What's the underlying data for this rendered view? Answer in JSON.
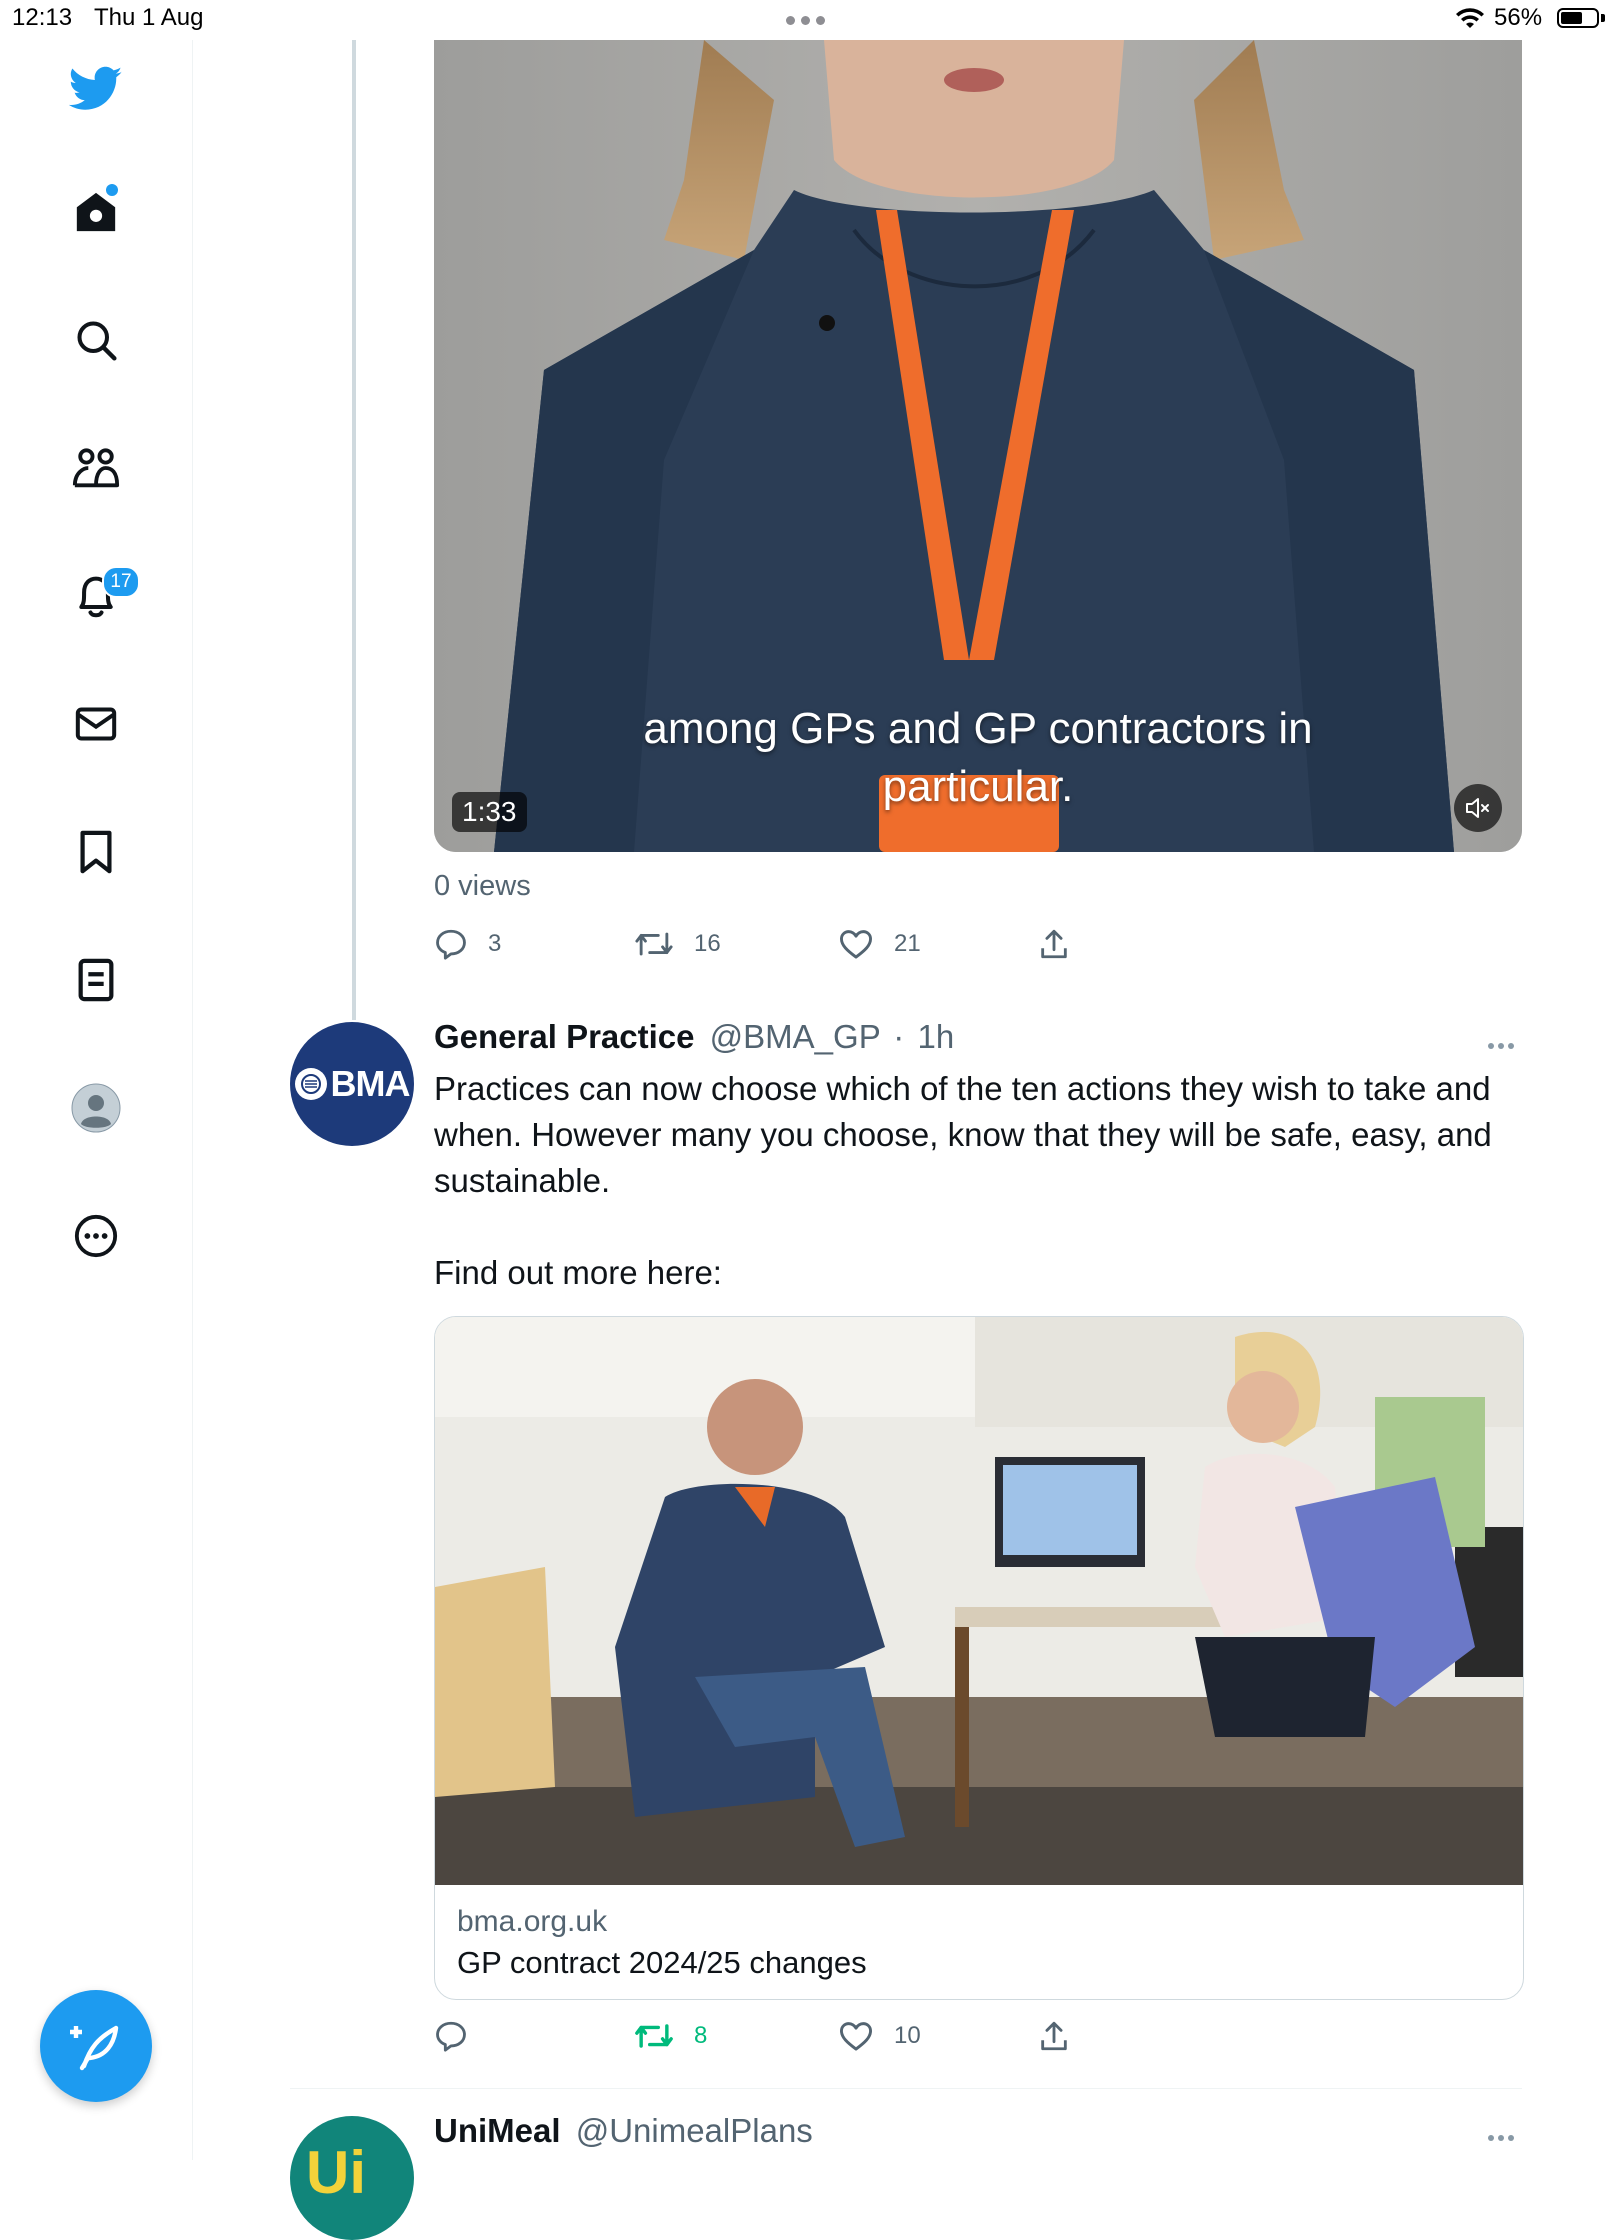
{
  "status_bar": {
    "time": "12:13",
    "date": "Thu 1 Aug",
    "battery": "56%"
  },
  "nav": {
    "notifications_badge": "17",
    "items": [
      "twitter-logo",
      "home-icon",
      "search-icon",
      "communities-icon",
      "notifications-icon",
      "messages-icon",
      "bookmarks-icon",
      "lists-icon",
      "profile-avatar",
      "more-icon"
    ],
    "accent": "#1d9bf0"
  },
  "video_tweet": {
    "caption_line1": "among GPs and GP contractors in",
    "caption_line2": "particular.",
    "duration": "1:33",
    "views": "0 views",
    "replies": "3",
    "retweets": "16",
    "likes": "21"
  },
  "tweet": {
    "avatar_text": "BMA",
    "name": "General Practice",
    "handle": "@BMA_GP",
    "dot": "·",
    "time": "1h",
    "body_line1": "Practices can now choose which of the ten actions they wish to take and when. However many you choose, know that they will be safe, easy, and sustainable.",
    "body_line2": "Find out more here:",
    "card_domain": "bma.org.uk",
    "card_title": "GP contract 2024/25 changes",
    "replies": "",
    "retweets": "8",
    "likes": "10",
    "retweet_color": "#00ba7c"
  },
  "next_tweet": {
    "avatar_text": "Ui",
    "name": "UniMeal",
    "handle": "@UnimealPlans"
  }
}
